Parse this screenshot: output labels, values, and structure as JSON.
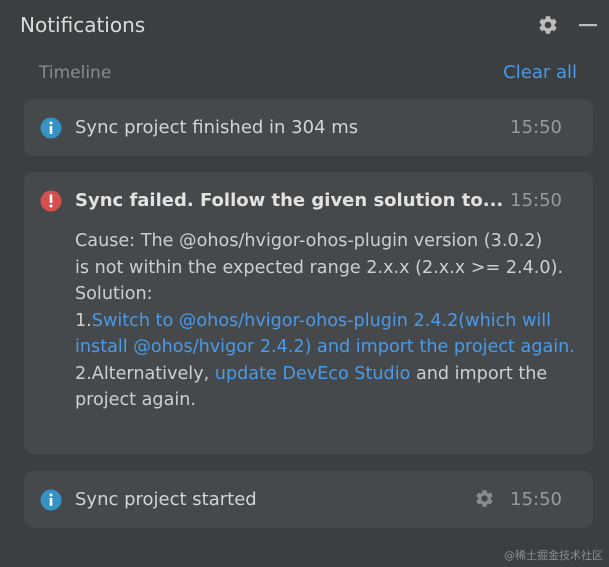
{
  "header": {
    "title": "Notifications",
    "settings_icon": "gear-icon",
    "minimize_icon": "minus-icon"
  },
  "timeline": {
    "label": "Timeline",
    "clear_all": "Clear all"
  },
  "notifications": [
    {
      "icon": "info-icon",
      "message": "Sync project finished in 304 ms",
      "time": "15:50"
    },
    {
      "icon": "error-icon",
      "title": "Sync failed. Follow the given solution to...",
      "time": "15:50",
      "cause_line1": "Cause: The @ohos/hvigor-ohos-plugin version (3.0.2)",
      "cause_line2": "is not within the expected range 2.x.x (2.x.x >= 2.4.0).",
      "solution_label": "Solution:",
      "step1_prefix": "1.",
      "step1_link": "Switch to @ohos/hvigor-ohos-plugin 2.4.2(which will install @ohos/hvigor 2.4.2) and import the project again.",
      "step2_prefix": "2.Alternatively, ",
      "step2_link": "update DevEco Studio",
      "step2_suffix": " and import the project again."
    },
    {
      "icon": "info-icon",
      "message": "Sync project started",
      "time": "15:50",
      "action_icon": "gear-icon"
    }
  ],
  "watermark": "@稀土掘金技术社区",
  "colors": {
    "link": "#4b9ae8",
    "info": "#3592c4",
    "error": "#d64f4f",
    "card": "#45494b",
    "background": "#3c3f41"
  }
}
